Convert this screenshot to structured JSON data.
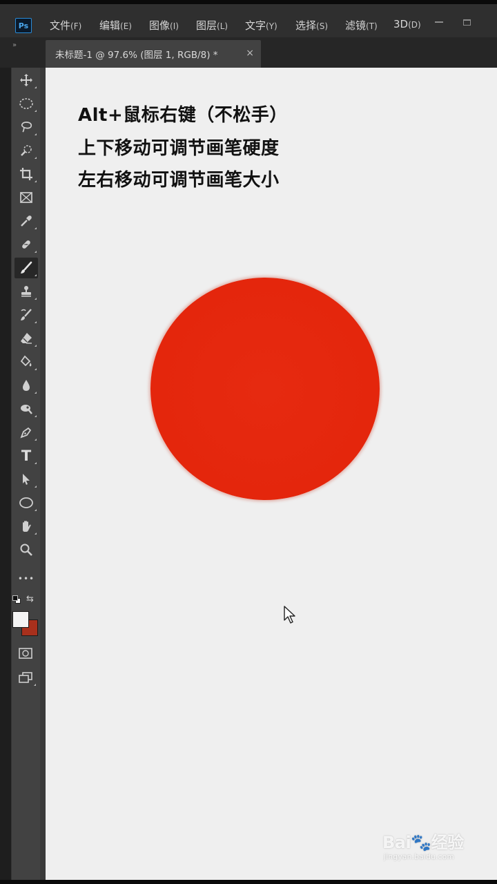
{
  "app": {
    "logo": "Ps"
  },
  "menu": [
    {
      "label": "文件",
      "hotkey": "(F)"
    },
    {
      "label": "编辑",
      "hotkey": "(E)"
    },
    {
      "label": "图像",
      "hotkey": "(I)"
    },
    {
      "label": "图层",
      "hotkey": "(L)"
    },
    {
      "label": "文字",
      "hotkey": "(Y)"
    },
    {
      "label": "选择",
      "hotkey": "(S)"
    },
    {
      "label": "滤镜",
      "hotkey": "(T)"
    },
    {
      "label": "3D",
      "hotkey": "(D)"
    }
  ],
  "panel_toggle": "»",
  "document_tab": {
    "title": "未标题-1 @ 97.6% (图层 1, RGB/8) *",
    "close": "×"
  },
  "tools": [
    "move-icon",
    "elliptical-marquee-icon",
    "lasso-icon",
    "quick-selection-icon",
    "crop-icon",
    "frame-icon",
    "eyedropper-icon",
    "healing-brush-icon",
    "brush-icon",
    "clone-stamp-icon",
    "history-brush-icon",
    "eraser-icon",
    "paint-bucket-icon",
    "blur-icon",
    "dodge-icon",
    "pen-icon",
    "type-icon",
    "path-selection-icon",
    "ellipse-shape-icon",
    "hand-icon",
    "zoom-icon",
    "more-tools-icon"
  ],
  "type_tool_glyph": "T",
  "more_tools_glyph": "•••",
  "swap_glyph": "⇆",
  "colors": {
    "foreground": "#f4f4f4",
    "background": "#a8301c",
    "brush": "#e4260c"
  },
  "canvas_text": [
    "Alt+鼠标右键（不松手）",
    "上下移动可调节画笔硬度",
    "左右移动可调节画笔大小"
  ],
  "watermark": {
    "main": "Bai🐾经验",
    "sub": "jingyan.baidu.com"
  }
}
